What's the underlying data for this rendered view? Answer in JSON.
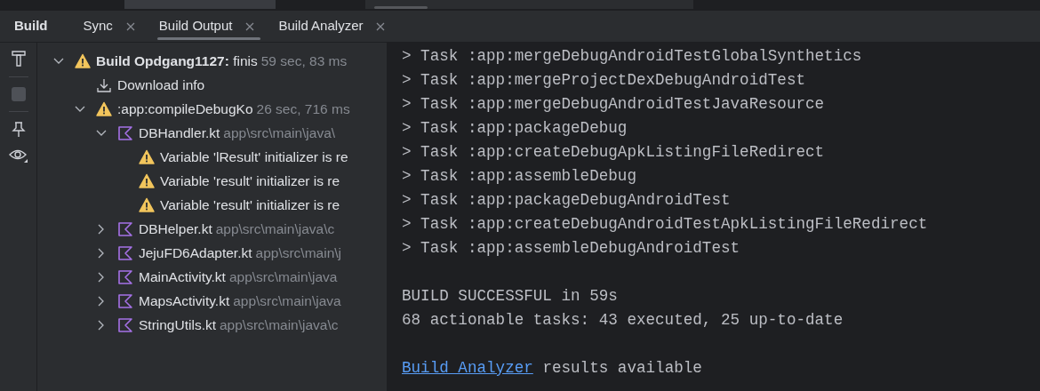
{
  "tool_window": {
    "title": "Build"
  },
  "tabs": [
    {
      "label": "Sync",
      "selected": false
    },
    {
      "label": "Build Output",
      "selected": true
    },
    {
      "label": "Build Analyzer",
      "selected": false
    }
  ],
  "toolbar": [
    {
      "kind": "hammer"
    },
    {
      "kind": "stop",
      "disabled": true
    },
    {
      "kind": "pin"
    },
    {
      "kind": "eye"
    }
  ],
  "tree": [
    {
      "kind": "warning",
      "label": "**Build Opdgang1127:** finis",
      "detail": "59 sec, 83 ms",
      "expanded": true,
      "children": [
        {
          "kind": "download",
          "label": "Download info"
        },
        {
          "kind": "warning",
          "label": ":app:compileDebugKo",
          "detail": "26 sec, 716 ms",
          "expanded": true,
          "children": [
            {
              "kind": "kotlin",
              "label": "DBHandler.kt",
              "detail": "app\\src\\main\\java\\",
              "expanded": true,
              "children": [
                {
                  "kind": "warning",
                  "label": "Variable 'lResult' initializer is re"
                },
                {
                  "kind": "warning",
                  "label": "Variable 'result' initializer is re"
                },
                {
                  "kind": "warning",
                  "label": "Variable 'result' initializer is re"
                }
              ]
            },
            {
              "kind": "kotlin",
              "label": "DBHelper.kt",
              "detail": "app\\src\\main\\java\\c",
              "expanded": false
            },
            {
              "kind": "kotlin",
              "label": "JejuFD6Adapter.kt",
              "detail": "app\\src\\main\\j",
              "expanded": false
            },
            {
              "kind": "kotlin",
              "label": "MainActivity.kt",
              "detail": "app\\src\\main\\java",
              "expanded": false
            },
            {
              "kind": "kotlin",
              "label": "MapsActivity.kt",
              "detail": "app\\src\\main\\java",
              "expanded": false
            },
            {
              "kind": "kotlin",
              "label": "StringUtils.kt",
              "detail": "app\\src\\main\\java\\c",
              "expanded": false
            }
          ]
        }
      ]
    }
  ],
  "console": {
    "tasks": [
      "> Task :app:mergeDebugAndroidTestGlobalSynthetics",
      "> Task :app:mergeProjectDexDebugAndroidTest",
      "> Task :app:mergeDebugAndroidTestJavaResource",
      "> Task :app:packageDebug",
      "> Task :app:createDebugApkListingFileRedirect",
      "> Task :app:assembleDebug",
      "> Task :app:packageDebugAndroidTest",
      "> Task :app:createDebugAndroidTestApkListingFileRedirect",
      "> Task :app:assembleDebugAndroidTest"
    ],
    "summary": [
      "BUILD SUCCESSFUL in 59s",
      "68 actionable tasks: 43 executed, 25 up-to-date"
    ],
    "footer": {
      "link": "Build Analyzer",
      "text": "results available"
    }
  }
}
